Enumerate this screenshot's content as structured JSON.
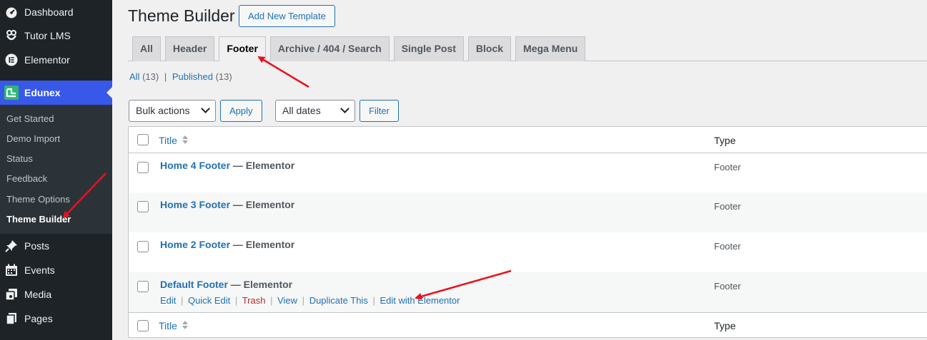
{
  "sidebar": {
    "top_items": [
      {
        "label": "Dashboard",
        "icon": "dashboard-icon"
      },
      {
        "label": "Tutor LMS",
        "icon": "tutor-icon"
      },
      {
        "label": "Elementor",
        "icon": "elementor-icon"
      },
      {
        "label": "Edunex",
        "icon": "edunex-icon"
      }
    ],
    "submenu": [
      "Get Started",
      "Demo Import",
      "Status",
      "Feedback",
      "Theme Options",
      "Theme Builder"
    ],
    "bottom_items": [
      {
        "label": "Posts",
        "icon": "pin-icon"
      },
      {
        "label": "Events",
        "icon": "calendar-icon"
      },
      {
        "label": "Media",
        "icon": "media-icon"
      },
      {
        "label": "Pages",
        "icon": "pages-icon"
      }
    ]
  },
  "header": {
    "title": "Theme Builder",
    "add_new": "Add New Template"
  },
  "tabs": [
    "All",
    "Header",
    "Footer",
    "Archive / 404 / Search",
    "Single Post",
    "Block",
    "Mega Menu"
  ],
  "active_tab": "Footer",
  "filters": {
    "all_label": "All",
    "all_count": "(13)",
    "separator": "|",
    "published_label": "Published",
    "published_count": "(13)"
  },
  "toolbar": {
    "bulk_actions": "Bulk actions",
    "apply": "Apply",
    "dates": "All dates",
    "filter": "Filter"
  },
  "table": {
    "col_title": "Title",
    "col_type": "Type",
    "rows": [
      {
        "title": "Home 4 Footer",
        "suffix": "— Elementor",
        "type": "Footer"
      },
      {
        "title": "Home 3 Footer",
        "suffix": "— Elementor",
        "type": "Footer"
      },
      {
        "title": "Home 2 Footer",
        "suffix": "— Elementor",
        "type": "Footer"
      },
      {
        "title": "Default Footer",
        "suffix": "— Elementor",
        "type": "Footer"
      }
    ],
    "row_actions": {
      "edit": "Edit",
      "quick_edit": "Quick Edit",
      "trash": "Trash",
      "view": "View",
      "duplicate": "Duplicate This",
      "edit_elementor": "Edit with Elementor",
      "separator": "|"
    }
  },
  "colors": {
    "sidebar_bg": "#1d2327",
    "active_menu": "#3858e9",
    "link": "#2271b1",
    "annotation_arrow": "#e8121b"
  }
}
